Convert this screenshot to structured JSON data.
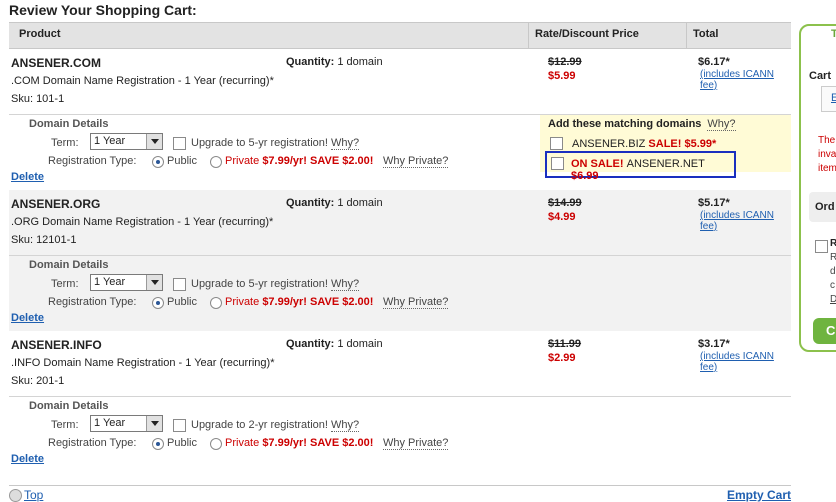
{
  "page": {
    "title": "Review Your Shopping Cart:"
  },
  "table": {
    "headers": {
      "product": "Product",
      "rate": "Rate/Discount Price",
      "total": "Total"
    }
  },
  "labels": {
    "domain_details": "Domain Details",
    "term": "Term:",
    "registration_type": "Registration Type:",
    "public": "Public",
    "private": "Private",
    "private_offer": "$7.99/yr! SAVE $2.00!",
    "why_private": "Why Private?",
    "why": "Why?",
    "quantity": "Quantity:",
    "quantity_value": "1 domain",
    "icann": "(includes ICANN fee)",
    "delete": "Delete"
  },
  "items": [
    {
      "name": "ANSENER.COM",
      "desc": ".COM Domain Name Registration - 1 Year (recurring)*",
      "sku": "Sku: 101-1",
      "old_price": "$12.99",
      "new_price": "$5.99",
      "total": "$6.17*",
      "term": "1 Year",
      "upgrade": "Upgrade to 5-yr registration!"
    },
    {
      "name": "ANSENER.ORG",
      "desc": ".ORG Domain Name Registration - 1 Year (recurring)*",
      "sku": "Sku: 12101-1",
      "old_price": "$14.99",
      "new_price": "$4.99",
      "total": "$5.17*",
      "term": "1 Year",
      "upgrade": "Upgrade to 5-yr registration!"
    },
    {
      "name": "ANSENER.INFO",
      "desc": ".INFO Domain Name Registration - 1 Year (recurring)*",
      "sku": "Sku: 201-1",
      "old_price": "$11.99",
      "new_price": "$2.99",
      "total": "$3.17*",
      "term": "1 Year",
      "upgrade": "Upgrade to 2-yr registration!"
    }
  ],
  "suggestions": {
    "title": "Add these matching domains",
    "why": "Why?",
    "biz_name": "ANSENER.BIZ",
    "biz_sale": "SALE! $5.99*",
    "net_onsale": "ON SALE!",
    "net_name": "ANSENER.NET",
    "net_price": "$6.99"
  },
  "footer": {
    "top": "Top",
    "empty_cart": "Empty Cart"
  },
  "sidebar": {
    "title_fragment": "T",
    "cart_label": "Cart",
    "link_fragment": "E",
    "red_lines": [
      "The",
      "inva",
      "item"
    ],
    "order_fragment": "Ord",
    "r_lines": [
      "R",
      "R",
      "d",
      "c",
      "D"
    ],
    "go_fragment": "C"
  },
  "colors": {
    "accent_red": "#cc0000",
    "link_blue": "#1f5fb0",
    "highlight_box": "#1a2fbf",
    "sidebar_green": "#8cc14c"
  }
}
